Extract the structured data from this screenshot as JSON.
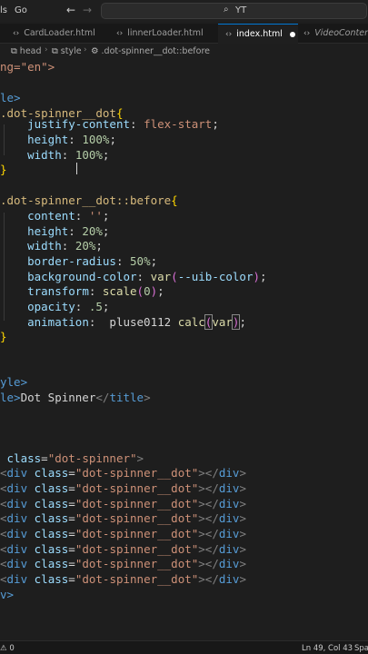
{
  "titlebar": {
    "menu": [
      "ls",
      "Go"
    ],
    "search_text": "YT"
  },
  "tabs": [
    {
      "label": "CardLoader.html",
      "active": false
    },
    {
      "label": "linnerLoader.html",
      "active": false
    },
    {
      "label": "index.html",
      "active": true,
      "dirty": true
    },
    {
      "label": "VideoContent.t",
      "active": false,
      "italic": true
    }
  ],
  "breadcrumb": {
    "items": [
      "html",
      "head",
      "style",
      ".dot-spinner__dot::before"
    ]
  },
  "code_lines": [
    "ng=\"en\">",
    "",
    "le>",
    ".dot-spinner__dot{",
    "    justify-content: flex-start;",
    "    height: 100%;",
    "    width: 100%;",
    "}",
    "",
    ".dot-spinner__dot::before{",
    "    content: '';",
    "    height: 20%;",
    "    width: 20%;",
    "    border-radius: 50%;",
    "    background-color: var(--uib-color);",
    "    transform: scale(0);",
    "    opacity: .5;",
    "    animation:  pluse0112 calc(var);",
    "}",
    "",
    "",
    "yle>",
    "le>Dot Spinner</title>",
    "",
    "",
    "",
    " class=\"dot-spinner\">",
    "<div class=\"dot-spinner__dot\"></div>",
    "<div class=\"dot-spinner__dot\"></div>",
    "<div class=\"dot-spinner__dot\"></div>",
    "<div class=\"dot-spinner__dot\"></div>",
    "<div class=\"dot-spinner__dot\"></div>",
    "<div class=\"dot-spinner__dot\"></div>",
    "<div class=\"dot-spinner__dot\"></div>",
    "<div class=\"dot-spinner__dot\"></div>",
    "v>"
  ],
  "statusbar": {
    "left": "⚠ 0",
    "position": "Ln 49, Col 43",
    "spaces": "Spa"
  },
  "colors": {
    "background": "#1e1e1e",
    "keyword": "#569cd6",
    "selector": "#d7ba7d",
    "property": "#9cdcfe",
    "number": "#b5cea8",
    "string": "#ce9178",
    "function": "#dcdcaa",
    "accent": "#0078d4"
  }
}
